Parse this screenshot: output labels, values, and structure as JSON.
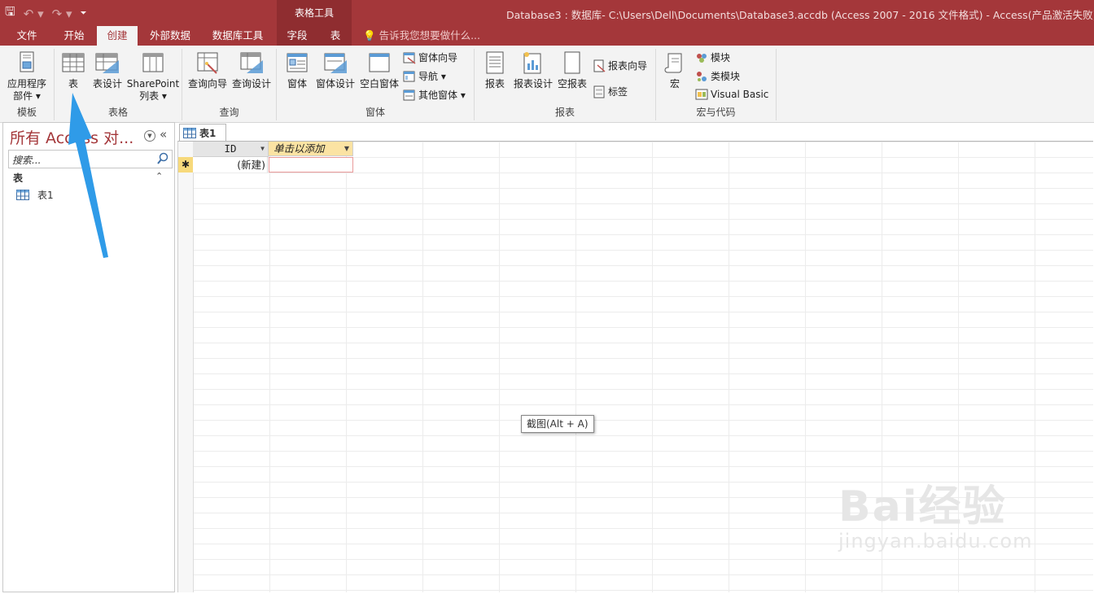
{
  "window": {
    "title": "Database3 : 数据库- C:\\Users\\Dell\\Documents\\Database3.accdb (Access 2007 - 2016 文件格式) - Access(产品激活失败)",
    "context_tool_header": "表格工具"
  },
  "tabs": [
    "文件",
    "开始",
    "创建",
    "外部数据",
    "数据库工具",
    "字段",
    "表"
  ],
  "active_tab": "创建",
  "tell_me": "告诉我您想要做什么...",
  "ribbon": {
    "templates": {
      "label": "模板",
      "app_parts_line1": "应用程序",
      "app_parts_line2": "部件 ▾"
    },
    "tables": {
      "label": "表格",
      "table": "表",
      "table_design": "表设计",
      "sharepoint_line1": "SharePoint",
      "sharepoint_line2": "列表 ▾"
    },
    "queries": {
      "label": "查询",
      "query_wizard": "查询向导",
      "query_design": "查询设计"
    },
    "forms": {
      "label": "窗体",
      "form": "窗体",
      "form_design": "窗体设计",
      "blank_form": "空白窗体",
      "form_wizard": "窗体向导",
      "navigation": "导航 ▾",
      "more_forms": "其他窗体 ▾"
    },
    "reports": {
      "label": "报表",
      "report": "报表",
      "report_design": "报表设计",
      "blank_report": "空报表",
      "report_wizard": "报表向导",
      "labels": "标签"
    },
    "macros": {
      "label": "宏与代码",
      "macro": "宏",
      "module": "模块",
      "class_module": "类模块",
      "visual_basic": "Visual Basic"
    }
  },
  "nav_pane": {
    "title": "所有 Access 对...",
    "collapse": "«",
    "search_placeholder": "搜索...",
    "category": "表",
    "category_toggle": "⌃",
    "items": [
      "表1"
    ]
  },
  "document": {
    "tab_label": "表1",
    "columns": [
      "ID",
      "单击以添加"
    ],
    "new_row_marker": "✱",
    "new_row_value": "(新建)"
  },
  "tooltip": "截图(Alt + A)",
  "watermark": {
    "main": "Bai经验",
    "sub": "jingyan.baidu.com"
  },
  "colors": {
    "accent": "#a4373a",
    "header_yellow": "#fbe3a3",
    "arrow": "#2f9be8"
  }
}
